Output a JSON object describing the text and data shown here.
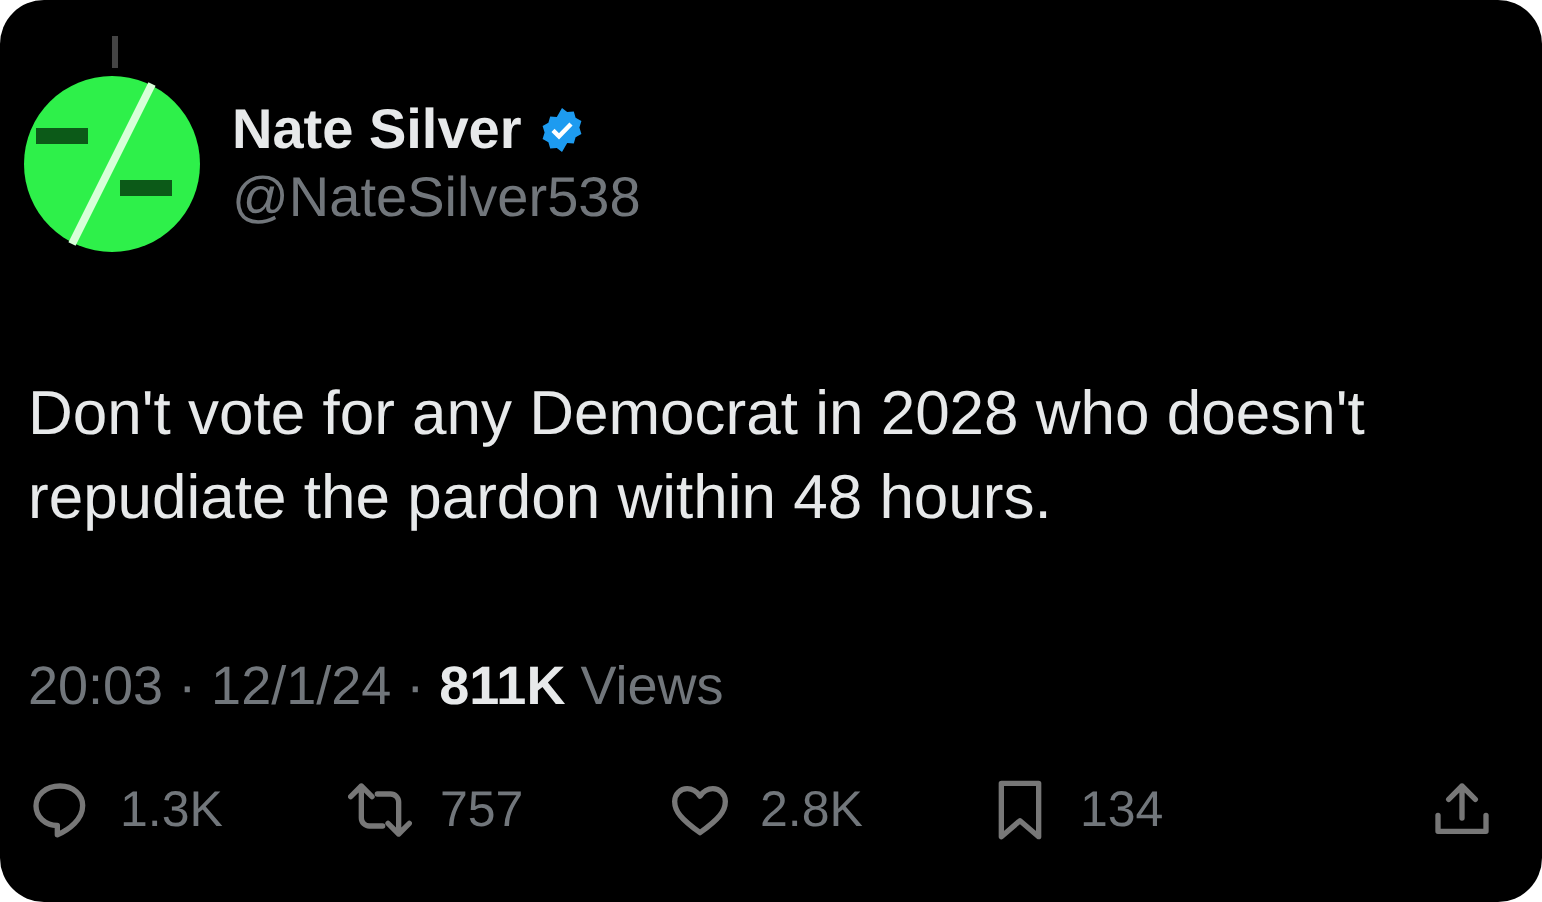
{
  "author": {
    "name": "Nate Silver",
    "verified": true,
    "handle": "@NateSilver538"
  },
  "text": "Don't vote for any Democrat in 2028 who doesn't repudiate the pardon within 48 hours.",
  "meta": "20:03 · 12/1/24 · **811K** Views",
  "actions": [
    {
      "kind": "reply",
      "count": "1.3K"
    },
    {
      "kind": "repost",
      "count": "757"
    },
    {
      "kind": "like",
      "count": "2.8K"
    },
    {
      "kind": "bookmark",
      "count": "134"
    },
    {
      "kind": "share"
    }
  ]
}
